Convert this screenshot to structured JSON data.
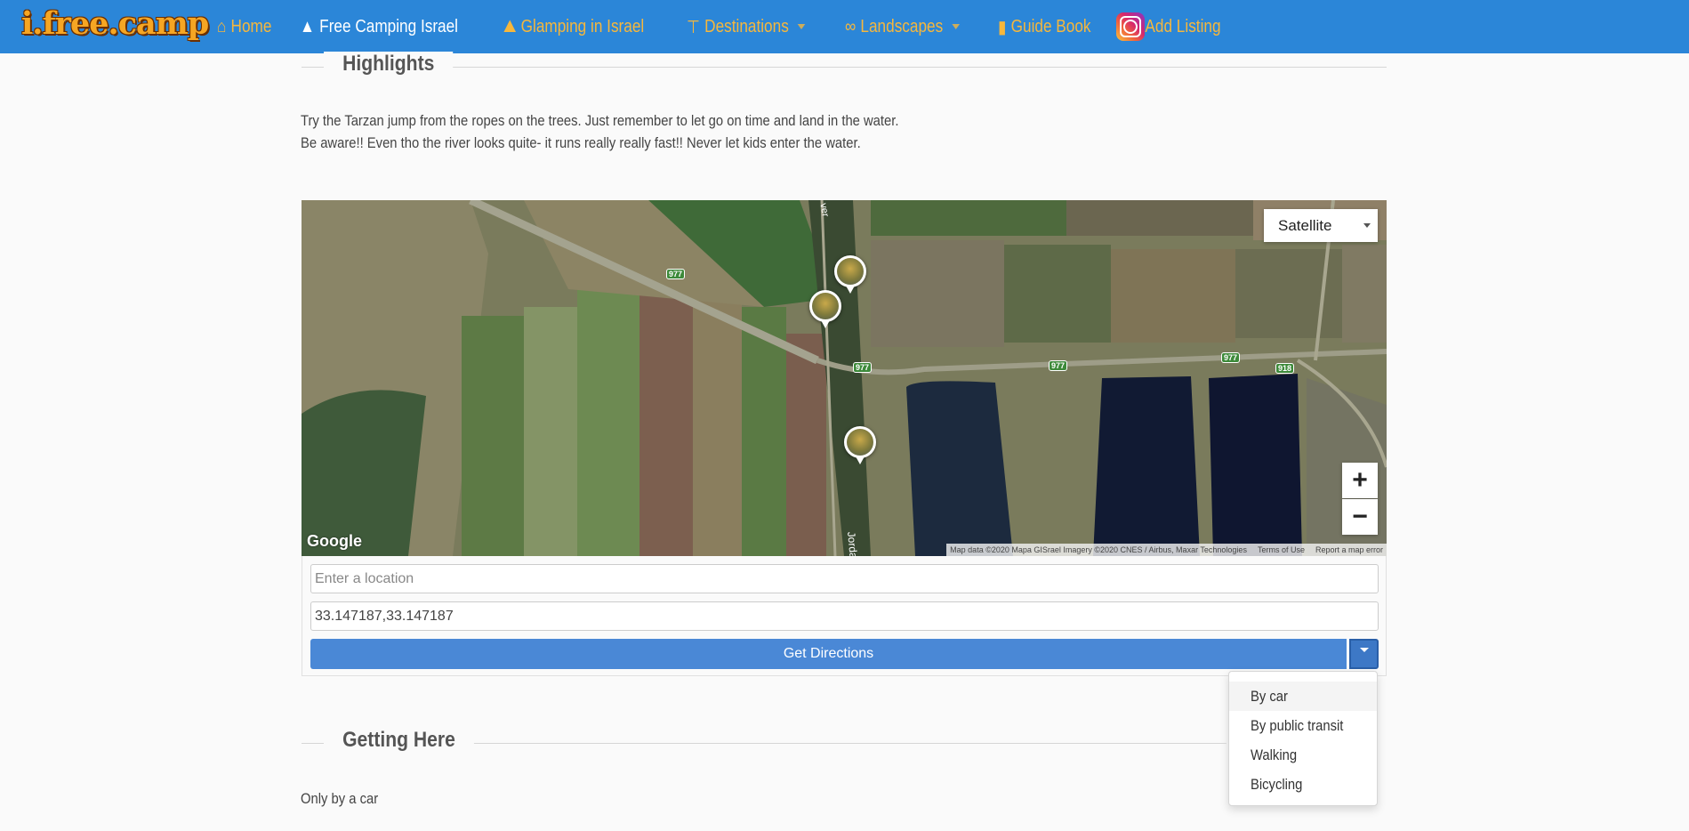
{
  "brand": {
    "logo_text": "i.free.camp"
  },
  "nav": {
    "items": [
      {
        "label": "Home",
        "icon": "home-icon"
      },
      {
        "label": "Free Camping Israel",
        "icon": "tent-icon",
        "active": true
      },
      {
        "label": "Glamping in Israel",
        "icon": "glamping-icon"
      },
      {
        "label": "Destinations",
        "icon": "signpost-icon",
        "dropdown": true
      },
      {
        "label": "Landscapes",
        "icon": "binoculars-icon",
        "dropdown": true
      },
      {
        "label": "Guide Book",
        "icon": "book-icon"
      },
      {
        "label": "Add Listing",
        "icon": "clipboard-icon"
      }
    ],
    "social_icon": "instagram-icon"
  },
  "highlights": {
    "title": "Highlights",
    "line1": "Try the Tarzan jump from the ropes on the trees. Just remember to let go on time and land in the water.",
    "line2": "Be aware!! Even tho the river looks quite- it runs really really fast!! Never let kids enter the water."
  },
  "map": {
    "type_control": "Satellite",
    "zoom_in": "+",
    "zoom_out": "−",
    "provider_logo": "Google",
    "attribution": "Map data ©2020 Mapa GISrael Imagery ©2020 CNES / Airbus, Maxar Technologies",
    "terms": "Terms of Use",
    "report": "Report a map error",
    "road_labels": [
      "977",
      "977",
      "977",
      "977",
      "918"
    ],
    "water_label_1": "ver",
    "water_label_2": "Jorda"
  },
  "directions": {
    "location_placeholder": "Enter a location",
    "destination_value": "33.147187,33.147187",
    "button_label": "Get Directions",
    "modes": [
      "By car",
      "By public transit",
      "Walking",
      "Bicycling"
    ]
  },
  "getting_here": {
    "title": "Getting Here",
    "text": "Only by a car"
  },
  "colors": {
    "navbar": "#2b86d8",
    "nav_link": "#f6b73c",
    "button": "#4a88d6"
  }
}
